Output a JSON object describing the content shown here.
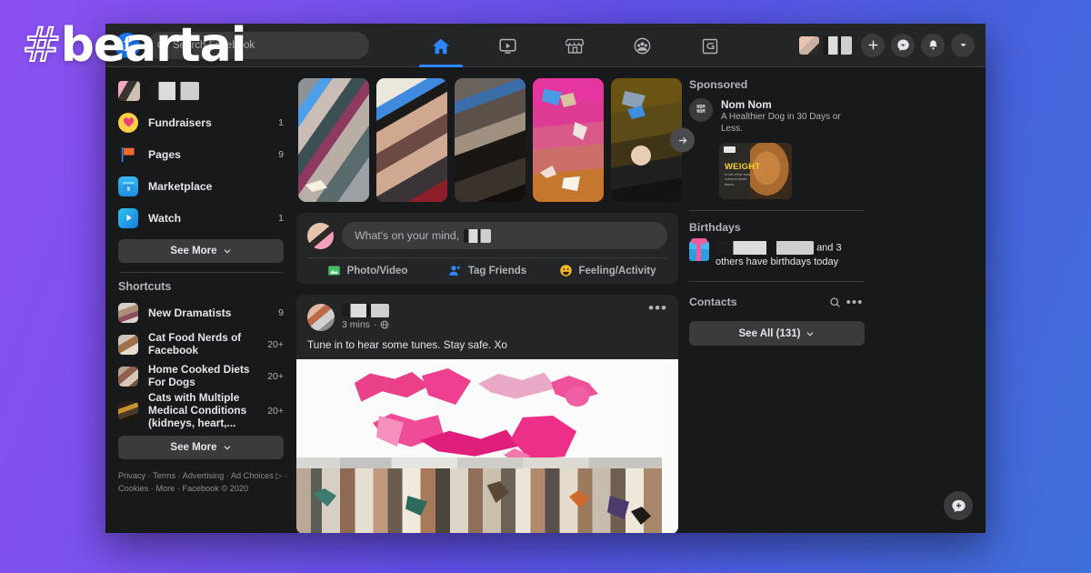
{
  "watermark": {
    "hash": "#",
    "name": "beartai"
  },
  "topbar": {
    "logo_letter": "f",
    "search_placeholder": "Search Facebook",
    "search_value": "",
    "search_icon": "search-icon",
    "tabs": [
      {
        "name": "home",
        "label": "Home",
        "icon": "home-icon",
        "active": true
      },
      {
        "name": "watch",
        "label": "Watch",
        "icon": "video-icon",
        "active": false
      },
      {
        "name": "marketplace",
        "label": "Marketplace",
        "icon": "store-icon",
        "active": false
      },
      {
        "name": "groups",
        "label": "Groups",
        "icon": "groups-icon",
        "active": false
      },
      {
        "name": "gaming",
        "label": "Gaming",
        "icon": "gaming-icon",
        "active": false
      }
    ],
    "profile_name": "",
    "actions": [
      {
        "name": "create",
        "icon": "plus-icon"
      },
      {
        "name": "messenger",
        "icon": "messenger-icon"
      },
      {
        "name": "notifications",
        "icon": "bell-icon"
      },
      {
        "name": "account-menu",
        "icon": "chevron-down-icon"
      }
    ]
  },
  "sidebar": {
    "profile_label": "",
    "items": [
      {
        "label": "Fundraisers",
        "badge": "1",
        "icon": "heart-circle-icon"
      },
      {
        "label": "Pages",
        "badge": "9",
        "icon": "flag-icon"
      },
      {
        "label": "Marketplace",
        "badge": "",
        "icon": "store-icon"
      },
      {
        "label": "Watch",
        "badge": "1",
        "icon": "watch-play-icon"
      }
    ],
    "see_more_label": "See More",
    "shortcuts_header": "Shortcuts",
    "shortcuts": [
      {
        "label": "New Dramatists",
        "badge": "9"
      },
      {
        "label": "Cat Food Nerds of Facebook",
        "badge": "20+"
      },
      {
        "label": "Home Cooked Diets For Dogs",
        "badge": "20+"
      },
      {
        "label": "Cats with Multiple Medical Conditions (kidneys, heart,...",
        "badge": "20+"
      }
    ],
    "shortcuts_see_more_label": "See More",
    "footer_line1": "Privacy · Terms · Advertising · Ad Choices ▷ ·",
    "footer_line2": "Cookies · More · Facebook © 2020"
  },
  "feed": {
    "stories_next_icon": "arrow-right-icon",
    "stories": [
      {
        "name": "story-1"
      },
      {
        "name": "story-2"
      },
      {
        "name": "story-3"
      },
      {
        "name": "story-4"
      },
      {
        "name": "story-5"
      }
    ],
    "composer": {
      "placeholder_prefix": "What's on your mind,",
      "actions": [
        {
          "label": "Photo/Video",
          "icon": "photo-video-icon"
        },
        {
          "label": "Tag Friends",
          "icon": "tag-friends-icon"
        },
        {
          "label": "Feeling/Activity",
          "icon": "feeling-activity-icon"
        }
      ]
    },
    "post": {
      "author": "",
      "time": "3 mins",
      "privacy_icon": "globe-icon",
      "menu_icon": "ellipsis-icon",
      "text": "Tune in to hear some tunes. Stay safe. Xo"
    }
  },
  "rail": {
    "sponsored_title": "Sponsored",
    "ad": {
      "logo_text_line1": "NOM",
      "logo_text_line2": "NOM",
      "title": "Nom Nom",
      "subtitle": "A Healthier Dog in 30 Days or Less.",
      "image_headline": "WEIGHT",
      "image_subtext": "is one of the most common health issues"
    },
    "birthdays_title": "Birthdays",
    "birthdays_text_suffix": "and 3 others have birthdays today",
    "birthdays_icon": "gift-icon",
    "contacts_title": "Contacts",
    "contacts_search_icon": "search-icon",
    "contacts_menu_icon": "ellipsis-icon",
    "see_all_label": "See All (131)",
    "fab_icon": "new-message-icon"
  },
  "colors": {
    "accent": "#2d88ff",
    "surface": "#242526",
    "background": "#18191a",
    "text": "#e4e6eb",
    "muted": "#b0b3b8"
  }
}
